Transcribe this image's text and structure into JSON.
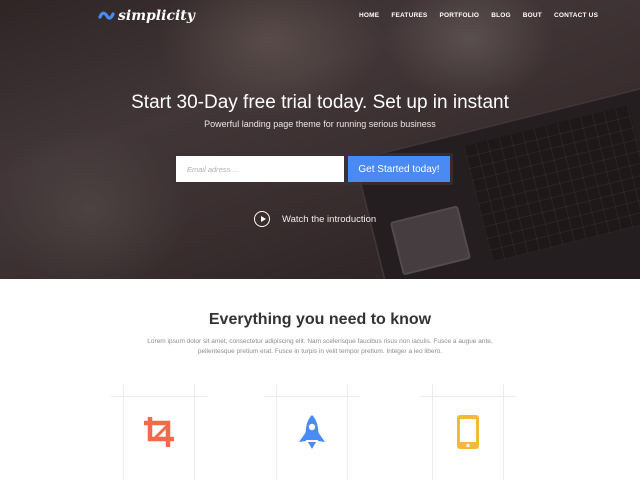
{
  "brand": {
    "name": "simplicity",
    "accent_color": "#4a8af4",
    "logo_icon": "s-swoosh-icon"
  },
  "nav": {
    "items": [
      "HOME",
      "FEATURES",
      "PORTFOLIO",
      "BLOG",
      "BOUT",
      "CONTACT US"
    ]
  },
  "hero": {
    "title": "Start 30-Day free trial today. Set up in instant",
    "subtitle": "Powerful landing page theme for running serious business",
    "email_placeholder": "Email adress ...",
    "cta_label": "Get Started today!",
    "watch_label": "Watch the introduction",
    "play_icon": "play-circle-icon"
  },
  "features": {
    "title": "Everything you need to know",
    "text": "Lorem ipsum dolor sit amet, consectetur adipiscing elit. Nam scelerisque faucibus risus non iaculis. Fusce a augue ante, pellentesque pretium erat. Fusce in turpis in velit tempor pretium. Integer a leo libero.",
    "items": [
      {
        "icon": "crop-icon",
        "color": "#f26a4b"
      },
      {
        "icon": "rocket-icon",
        "color": "#4a8af4"
      },
      {
        "icon": "mobile-phone-icon",
        "color": "#f5b93a"
      }
    ]
  }
}
